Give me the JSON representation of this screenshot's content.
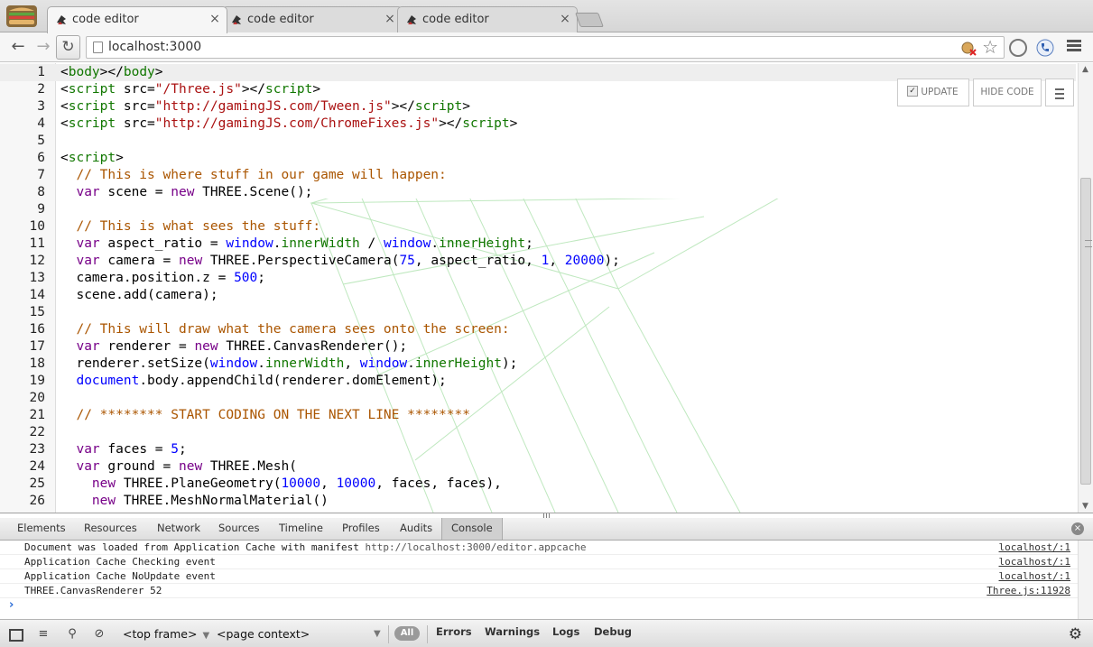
{
  "browser": {
    "tabs": [
      {
        "title": "code editor",
        "active": true
      },
      {
        "title": "code editor",
        "active": false
      },
      {
        "title": "code editor",
        "active": false
      }
    ],
    "tab_close_glyph": "×",
    "url": "localhost:3000"
  },
  "editor": {
    "controls": {
      "update_label": "UPDATE",
      "update_checked": true,
      "hide_code_label": "HIDE CODE"
    },
    "lines": [
      {
        "n": "1",
        "current": true,
        "parts": [
          [
            "",
            "<"
          ],
          [
            "tag",
            "body"
          ],
          [
            "",
            "></"
          ],
          [
            "tag",
            "body"
          ],
          [
            "",
            ">"
          ]
        ]
      },
      {
        "n": "2",
        "parts": [
          [
            "",
            "<"
          ],
          [
            "tag",
            "script"
          ],
          [
            "",
            " src="
          ],
          [
            "str",
            "\"/Three.js\""
          ],
          [
            "",
            "></"
          ],
          [
            "tag",
            "script"
          ],
          [
            "",
            ">"
          ]
        ]
      },
      {
        "n": "3",
        "parts": [
          [
            "",
            "<"
          ],
          [
            "tag",
            "script"
          ],
          [
            "",
            " src="
          ],
          [
            "str",
            "\"http://gamingJS.com/Tween.js\""
          ],
          [
            "",
            "></"
          ],
          [
            "tag",
            "script"
          ],
          [
            "",
            ">"
          ]
        ]
      },
      {
        "n": "4",
        "parts": [
          [
            "",
            "<"
          ],
          [
            "tag",
            "script"
          ],
          [
            "",
            " src="
          ],
          [
            "str",
            "\"http://gamingJS.com/ChromeFixes.js\""
          ],
          [
            "",
            "></"
          ],
          [
            "tag",
            "script"
          ],
          [
            "",
            ">"
          ]
        ]
      },
      {
        "n": "5",
        "parts": []
      },
      {
        "n": "6",
        "parts": [
          [
            "",
            "<"
          ],
          [
            "tag",
            "script"
          ],
          [
            "",
            ">"
          ]
        ]
      },
      {
        "n": "7",
        "parts": [
          [
            "",
            "  "
          ],
          [
            "com",
            "// This is where stuff in our game will happen:"
          ]
        ]
      },
      {
        "n": "8",
        "parts": [
          [
            "",
            "  "
          ],
          [
            "kw",
            "var"
          ],
          [
            "",
            " scene = "
          ],
          [
            "kw",
            "new"
          ],
          [
            "",
            " THREE.Scene();"
          ]
        ]
      },
      {
        "n": "9",
        "parts": []
      },
      {
        "n": "10",
        "parts": [
          [
            "",
            "  "
          ],
          [
            "com",
            "// This is what sees the stuff:"
          ]
        ]
      },
      {
        "n": "11",
        "parts": [
          [
            "",
            "  "
          ],
          [
            "kw",
            "var"
          ],
          [
            "",
            " aspect_ratio = "
          ],
          [
            "def",
            "window"
          ],
          [
            "",
            "."
          ],
          [
            "tag",
            "innerWidth"
          ],
          [
            "",
            " / "
          ],
          [
            "def",
            "window"
          ],
          [
            "",
            "."
          ],
          [
            "tag",
            "innerHeight"
          ],
          [
            "",
            ";"
          ]
        ]
      },
      {
        "n": "12",
        "parts": [
          [
            "",
            "  "
          ],
          [
            "kw",
            "var"
          ],
          [
            "",
            " camera = "
          ],
          [
            "kw",
            "new"
          ],
          [
            "",
            " THREE.PerspectiveCamera("
          ],
          [
            "def",
            "75"
          ],
          [
            "",
            ", aspect_ratio, "
          ],
          [
            "def",
            "1"
          ],
          [
            "",
            ", "
          ],
          [
            "def",
            "20000"
          ],
          [
            "",
            ");"
          ]
        ]
      },
      {
        "n": "13",
        "parts": [
          [
            "",
            "  camera.position.z = "
          ],
          [
            "def",
            "500"
          ],
          [
            "",
            ";"
          ]
        ]
      },
      {
        "n": "14",
        "parts": [
          [
            "",
            "  scene.add(camera);"
          ]
        ]
      },
      {
        "n": "15",
        "parts": []
      },
      {
        "n": "16",
        "parts": [
          [
            "",
            "  "
          ],
          [
            "com",
            "// This will draw what the camera sees onto the screen:"
          ]
        ]
      },
      {
        "n": "17",
        "parts": [
          [
            "",
            "  "
          ],
          [
            "kw",
            "var"
          ],
          [
            "",
            " renderer = "
          ],
          [
            "kw",
            "new"
          ],
          [
            "",
            " THREE.CanvasRenderer();"
          ]
        ]
      },
      {
        "n": "18",
        "parts": [
          [
            "",
            "  renderer.setSize("
          ],
          [
            "def",
            "window"
          ],
          [
            "",
            "."
          ],
          [
            "tag",
            "innerWidth"
          ],
          [
            "",
            ", "
          ],
          [
            "def",
            "window"
          ],
          [
            "",
            "."
          ],
          [
            "tag",
            "innerHeight"
          ],
          [
            "",
            ");"
          ]
        ]
      },
      {
        "n": "19",
        "parts": [
          [
            "",
            "  "
          ],
          [
            "def",
            "document"
          ],
          [
            "",
            ".body.appendChild(renderer.domElement);"
          ]
        ]
      },
      {
        "n": "20",
        "parts": []
      },
      {
        "n": "21",
        "parts": [
          [
            "",
            "  "
          ],
          [
            "com",
            "// ******** START CODING ON THE NEXT LINE ********"
          ]
        ]
      },
      {
        "n": "22",
        "parts": []
      },
      {
        "n": "23",
        "parts": [
          [
            "",
            "  "
          ],
          [
            "kw",
            "var"
          ],
          [
            "",
            " faces = "
          ],
          [
            "def",
            "5"
          ],
          [
            "",
            ";"
          ]
        ]
      },
      {
        "n": "24",
        "parts": [
          [
            "",
            "  "
          ],
          [
            "kw",
            "var"
          ],
          [
            "",
            " ground = "
          ],
          [
            "kw",
            "new"
          ],
          [
            "",
            " THREE.Mesh("
          ]
        ]
      },
      {
        "n": "25",
        "parts": [
          [
            "",
            "    "
          ],
          [
            "kw",
            "new"
          ],
          [
            "",
            " THREE.PlaneGeometry("
          ],
          [
            "def",
            "10000"
          ],
          [
            "",
            ", "
          ],
          [
            "def",
            "10000"
          ],
          [
            "",
            ", faces, faces),"
          ]
        ]
      },
      {
        "n": "26",
        "parts": [
          [
            "",
            "    "
          ],
          [
            "kw",
            "new"
          ],
          [
            "",
            " THREE.MeshNormalMaterial()"
          ]
        ]
      }
    ]
  },
  "devtools": {
    "tabs": [
      "Elements",
      "Resources",
      "Network",
      "Sources",
      "Timeline",
      "Profiles",
      "Audits",
      "Console"
    ],
    "active_tab": "Console",
    "console": [
      {
        "text": "Document was loaded from Application Cache with manifest ",
        "url": "http://localhost:3000/editor.appcache",
        "source": "localhost/:1"
      },
      {
        "text": "Application Cache Checking event",
        "url": "",
        "source": "localhost/:1"
      },
      {
        "text": "Application Cache NoUpdate event",
        "url": "",
        "source": "localhost/:1"
      },
      {
        "text": "THREE.CanvasRenderer 52",
        "url": "",
        "source": "Three.js:11928"
      }
    ],
    "prompt": "›",
    "statusbar": {
      "frame": "<top frame>",
      "context": "<page context>",
      "filter_all": "All",
      "filters": [
        "Errors",
        "Warnings",
        "Logs",
        "Debug"
      ]
    }
  },
  "colors": {
    "keyword": "#770088",
    "string": "#aa1111",
    "comment": "#aa5500",
    "tag": "#117700",
    "number": "#0000ff"
  }
}
